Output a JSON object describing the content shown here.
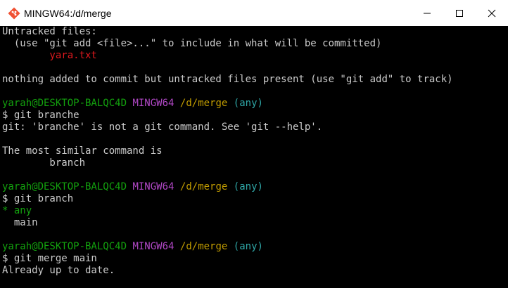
{
  "window": {
    "title": "MINGW64:/d/merge",
    "icon": "git-bash-icon"
  },
  "controls": {
    "minimize": "minimize-icon",
    "maximize": "maximize-icon",
    "close": "close-icon"
  },
  "colors": {
    "prompt_user": "#13a10e",
    "prompt_shell": "#b148c6",
    "prompt_path": "#c19c00",
    "prompt_branch": "#2fa8a8",
    "untracked_file": "#e0191e",
    "current_branch": "#13a10e",
    "text": "#cccccc",
    "background": "#000000"
  },
  "terminal": {
    "untracked_header": "Untracked files:",
    "untracked_hint": "  (use \"git add <file>...\" to include in what will be committed)",
    "untracked_file": "        yara.txt",
    "nothing_added": "nothing added to commit but untracked files present (use \"git add\" to track)",
    "prompts": [
      {
        "user": "yarah@DESKTOP-BALQC4D",
        "shell": "MINGW64",
        "path": "/d/merge",
        "branch": "(any)",
        "command": "$ git branche"
      },
      {
        "user": "yarah@DESKTOP-BALQC4D",
        "shell": "MINGW64",
        "path": "/d/merge",
        "branch": "(any)",
        "command": "$ git branch"
      },
      {
        "user": "yarah@DESKTOP-BALQC4D",
        "shell": "MINGW64",
        "path": "/d/merge",
        "branch": "(any)",
        "command": "$ git merge main"
      }
    ],
    "error_line": "git: 'branche' is not a git command. See 'git --help'.",
    "similar_header": "The most similar command is",
    "similar_cmd": "        branch",
    "branch_current": "* any",
    "branch_other": "  main",
    "merge_result": "Already up to date."
  }
}
